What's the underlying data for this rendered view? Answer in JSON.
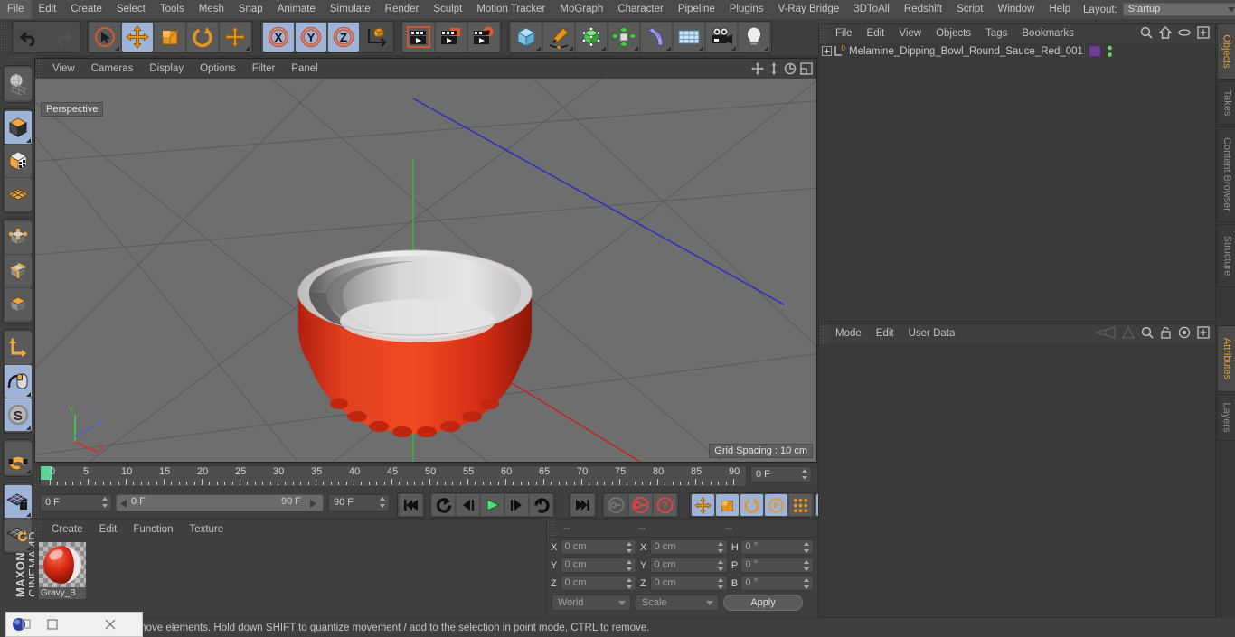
{
  "app": {
    "brand_line1": "MAXON",
    "brand_line2": "CINEMA 4D"
  },
  "menubar": {
    "items": [
      "File",
      "Edit",
      "Create",
      "Select",
      "Tools",
      "Mesh",
      "Snap",
      "Animate",
      "Simulate",
      "Render",
      "Sculpt",
      "Motion Tracker",
      "MoGraph",
      "Character",
      "Pipeline",
      "Plugins",
      "V-Ray Bridge",
      "3DToAll",
      "Redshift",
      "Script",
      "Window",
      "Help"
    ],
    "layout_label": "Layout:",
    "layout_value": "Startup",
    "search_icon": "search-icon"
  },
  "toolbar": {
    "groups": [
      {
        "name": "undo-redo",
        "buttons": [
          {
            "name": "undo",
            "icon": "undo-arrow-icon",
            "state": "flat"
          },
          {
            "name": "redo",
            "icon": "redo-arrow-icon",
            "state": "flat-disabled"
          }
        ]
      },
      {
        "name": "tools",
        "buttons": [
          {
            "name": "live-selection",
            "icon": "cursor-circle-icon",
            "state": "off"
          },
          {
            "name": "move",
            "icon": "move-arrows-icon",
            "state": "on"
          },
          {
            "name": "scale",
            "icon": "scale-box-icon",
            "state": "off"
          },
          {
            "name": "rotate",
            "icon": "rotate-circle-icon",
            "state": "off"
          },
          {
            "name": "move-dup",
            "icon": "move-arrows-icon",
            "state": "off"
          }
        ]
      },
      {
        "name": "axis-locks",
        "buttons": [
          {
            "name": "x-axis-lock",
            "icon": "x-axis-icon",
            "label": "X",
            "state": "on"
          },
          {
            "name": "y-axis-lock",
            "icon": "y-axis-icon",
            "label": "Y",
            "state": "on"
          },
          {
            "name": "z-axis-lock",
            "icon": "z-axis-icon",
            "label": "Z",
            "state": "on"
          },
          {
            "name": "world-object-axis",
            "icon": "world-coord-icon",
            "state": "off"
          }
        ]
      },
      {
        "name": "render",
        "buttons": [
          {
            "name": "render-view",
            "icon": "render-view-icon",
            "state": "off"
          },
          {
            "name": "render-to-picture-viewer",
            "icon": "render-picture-icon",
            "state": "off"
          },
          {
            "name": "render-settings",
            "icon": "render-settings-icon",
            "state": "off"
          }
        ]
      },
      {
        "name": "objects",
        "buttons": [
          {
            "name": "add-cube-object",
            "icon": "cube-blue-icon",
            "state": "off"
          },
          {
            "name": "add-spline",
            "icon": "pen-spline-icon",
            "state": "off"
          },
          {
            "name": "add-generator",
            "icon": "generator-green-icon",
            "state": "off"
          },
          {
            "name": "add-array",
            "icon": "array-green-icon",
            "state": "off"
          },
          {
            "name": "add-deformer",
            "icon": "bend-deformer-icon",
            "state": "off"
          },
          {
            "name": "add-environment",
            "icon": "floor-grid-icon",
            "state": "off"
          },
          {
            "name": "add-camera",
            "icon": "camera-icon",
            "state": "off"
          },
          {
            "name": "add-light",
            "icon": "light-bulb-icon",
            "state": "off"
          }
        ]
      }
    ]
  },
  "left_palette": {
    "groups": [
      [
        {
          "name": "undo-view",
          "icon": "globe-grid-icon",
          "state": "off"
        }
      ],
      [
        {
          "name": "model-mode",
          "icon": "cube-orange-icon",
          "state": "on"
        },
        {
          "name": "texture-mode",
          "icon": "cube-checker-icon",
          "state": "off"
        },
        {
          "name": "workplane-mode",
          "icon": "grid-diamond-icon",
          "state": "off"
        }
      ],
      [
        {
          "name": "points-mode",
          "icon": "points-cube-icon",
          "state": "off"
        },
        {
          "name": "edges-mode",
          "icon": "edges-cube-icon",
          "state": "off"
        },
        {
          "name": "polygons-mode",
          "icon": "polygons-cube-icon",
          "state": "off"
        }
      ],
      [
        {
          "name": "object-axis-mode",
          "icon": "axis-l-icon",
          "state": "off"
        },
        {
          "name": "enable-axis-mode",
          "icon": "mouse-axis-icon",
          "state": "on"
        },
        {
          "name": "viewport-solo-single",
          "icon": "s-circle-icon",
          "state": "on"
        }
      ],
      [
        {
          "name": "snap-toggle",
          "icon": "magnet-icon",
          "state": "off"
        }
      ],
      [
        {
          "name": "workplane-lock",
          "icon": "grid-lock-icon",
          "state": "on"
        },
        {
          "name": "workplane-rotate",
          "icon": "grid-rotate-icon",
          "state": "off"
        }
      ]
    ]
  },
  "viewport": {
    "menu": [
      "View",
      "Cameras",
      "Display",
      "Options",
      "Filter",
      "Panel"
    ],
    "label": "Perspective",
    "grid_spacing": "Grid Spacing : 10 cm",
    "nav_icons": [
      "pan-icon",
      "dolly-icon",
      "orbit-icon",
      "maximize-viewport-icon"
    ],
    "axis_gizmo": {
      "y": "Y",
      "z": "Z",
      "x": "X"
    },
    "scene": {
      "object_color": "#e23119",
      "interior_color": "#d8d8d8",
      "background": "#6e6e6e"
    }
  },
  "timeline": {
    "ticks": [
      "0",
      "5",
      "10",
      "15",
      "20",
      "25",
      "30",
      "35",
      "40",
      "45",
      "50",
      "55",
      "60",
      "65",
      "70",
      "75",
      "80",
      "85",
      "90"
    ],
    "current_frame": "0 F",
    "start": 0,
    "end": 90
  },
  "playback": {
    "current_frame": "0 F",
    "range_start": "0 F",
    "range_end": "90 F",
    "end_frame": "90 F",
    "buttons": [
      {
        "name": "go-to-start",
        "icon": "skip-start-icon",
        "state": "off"
      },
      {
        "name": "previous-key",
        "icon": "prev-key-icon",
        "state": "off"
      },
      {
        "name": "step-back",
        "icon": "step-back-icon",
        "state": "off"
      },
      {
        "name": "play",
        "icon": "play-icon",
        "state": "off"
      },
      {
        "name": "step-forward",
        "icon": "step-forward-icon",
        "state": "off"
      },
      {
        "name": "next-key",
        "icon": "next-key-icon",
        "state": "off"
      },
      {
        "name": "go-to-end",
        "icon": "skip-end-icon",
        "state": "off"
      },
      {
        "name": "autokey",
        "icon": "key-icon",
        "state": "off"
      },
      {
        "name": "record-active",
        "icon": "record-red-icon",
        "state": "off"
      },
      {
        "name": "keyframe-selection",
        "icon": "question-red-icon",
        "state": "off"
      },
      {
        "name": "record-position",
        "icon": "move-arrows-icon",
        "state": "on"
      },
      {
        "name": "record-scale",
        "icon": "scale-box-icon",
        "state": "on"
      },
      {
        "name": "record-rotation",
        "icon": "rotate-circle-icon",
        "state": "on"
      },
      {
        "name": "record-pla",
        "icon": "p-circle-icon",
        "state": "on"
      },
      {
        "name": "record-points",
        "icon": "dots-grid-icon",
        "state": "off"
      },
      {
        "name": "autokeying",
        "icon": "filmstrip-icon",
        "state": "on"
      }
    ]
  },
  "material_manager": {
    "menu": [
      "Create",
      "Edit",
      "Function",
      "Texture"
    ],
    "materials": [
      {
        "name": "Gravy_B",
        "color": "#cf2a1e"
      }
    ]
  },
  "coordinates": {
    "headers": [
      "--",
      "--",
      "--"
    ],
    "rows": [
      {
        "axis1": "X",
        "val1": "0 cm",
        "axis2": "X",
        "val2": "0 cm",
        "axis3": "H",
        "val3": "0 °"
      },
      {
        "axis1": "Y",
        "val1": "0 cm",
        "axis2": "Y",
        "val2": "0 cm",
        "axis3": "P",
        "val3": "0 °"
      },
      {
        "axis1": "Z",
        "val1": "0 cm",
        "axis2": "Z",
        "val2": "0 cm",
        "axis3": "B",
        "val3": "0 °"
      }
    ],
    "system": "World",
    "mode": "Scale",
    "apply": "Apply"
  },
  "object_manager": {
    "menu": [
      "File",
      "Edit",
      "View",
      "Objects",
      "Tags",
      "Bookmarks"
    ],
    "icons": [
      "search-icon",
      "home-icon",
      "ellipse-icon",
      "plus-box-icon"
    ],
    "objects": [
      {
        "name": "Melamine_Dipping_Bowl_Round_Sauce_Red_001",
        "tag_color": "#6b3f8f",
        "visible_dots": "#5fd35f"
      }
    ]
  },
  "attributes": {
    "menu": [
      "Mode",
      "Edit",
      "User Data"
    ],
    "icons": [
      "history-back-icon",
      "history-forward-icon",
      "search-icon",
      "lock-icon",
      "target-icon",
      "plus-box-icon"
    ]
  },
  "right_tabs_top": [
    "Objects",
    "Takes",
    "Content Browser",
    "Structure"
  ],
  "right_tabs_bottom": [
    "Attributes",
    "Layers"
  ],
  "status": {
    "message": "move elements. Hold down SHIFT to quantize movement / add to the selection in point mode, CTRL to remove."
  },
  "overlay_window": {
    "icons": [
      "app-orb-icon",
      "minimize-icon",
      "maximize-icon",
      "close-icon"
    ]
  }
}
